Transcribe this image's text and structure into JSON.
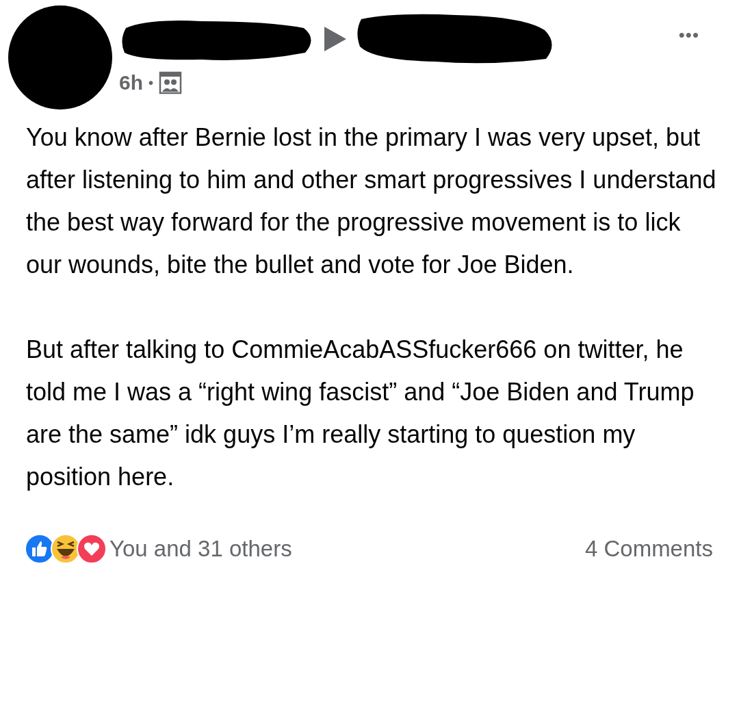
{
  "post": {
    "time": "6h",
    "separator": "•",
    "menu": "•••",
    "paragraphs": [
      "You know after Bernie lost in the primary I was very upset, but after listening to him and other smart progressives I understand the best way forward for the progressive movement is to lick our wounds, bite the bullet and vote for Joe Biden.",
      "But after talking to CommieAcabASSfucker666 on twitter, he told me I was a “right wing fascist” and “Joe Biden and Trump are the same” idk guys I’m really starting to question my position here."
    ],
    "reactions": {
      "summary": "You and 31 others",
      "comments": "4 Comments"
    }
  }
}
